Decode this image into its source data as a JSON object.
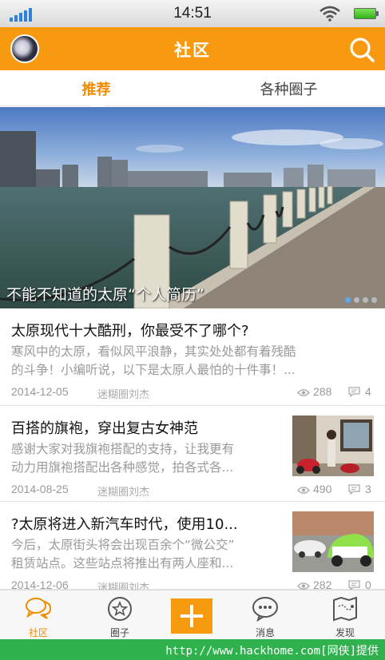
{
  "status_bar": {
    "time": "14:51"
  },
  "header": {
    "title": "社区",
    "avatar": "user-avatar",
    "search_icon": "search-icon"
  },
  "tabs": [
    {
      "label": "推荐",
      "active": true
    },
    {
      "label": "各种圈子",
      "active": false
    }
  ],
  "banner": {
    "caption": "不能不知道的太原“个人简历”",
    "slide_count": 4,
    "active_slide": 1
  },
  "articles": [
    {
      "title": "太原现代十大酷刑，你最受不了哪个?",
      "desc_line1": "寒风中的太原，看似风平浪静，其实处处都有着残酷",
      "desc_line2": "的斗争！小编听说，以下是太原人最怕的十件事！...",
      "date": "2014-12-05",
      "author": "迷糊圈刘杰",
      "views": "288",
      "comments": "4",
      "thumbnail": false
    },
    {
      "title": "百搭的旗袍，穿出复古女神范",
      "desc_line1": "感谢大家对我旗袍搭配的支持，让我更有",
      "desc_line2": "动力用旗袍搭配出各种感觉，拍各式各...",
      "date": "2014-08-25",
      "author": "迷糊圈刘杰",
      "views": "490",
      "comments": "3",
      "thumbnail": true
    },
    {
      "title": "?太原将进入新汽车时代，使用10...",
      "desc_line1": "今后，太原街头将会出现百余个“微公交”",
      "desc_line2": "租赁站点。这些站点将推出有两人座和...",
      "date": "2014-12-06",
      "author": "迷糊圈刘杰",
      "views": "282",
      "comments": "0",
      "thumbnail": true
    }
  ],
  "bottom_nav": [
    {
      "label": "社区",
      "icon": "chat-bubbles-icon",
      "active": true
    },
    {
      "label": "圈子",
      "icon": "star-circle-icon",
      "active": false
    },
    {
      "label": "",
      "icon": "plus-icon",
      "active": false
    },
    {
      "label": "消息",
      "icon": "message-dots-icon",
      "active": false
    },
    {
      "label": "发现",
      "icon": "map-icon",
      "active": false
    }
  ],
  "footer": {
    "text": "http://www.hackhome.com[网侠]提供"
  },
  "colors": {
    "accent": "#f79a0f",
    "footer": "#2fb14d"
  }
}
